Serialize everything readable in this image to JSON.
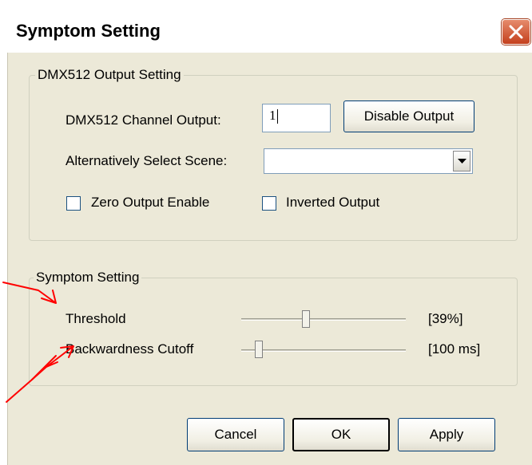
{
  "dialog": {
    "title": "Symptom Setting",
    "close_icon": "close-icon"
  },
  "dmx_group": {
    "label": "DMX512 Output Setting",
    "channel_label": "DMX512 Channel Output:",
    "channel_value": "1",
    "disable_button": "Disable Output",
    "scene_label": "Alternatively Select Scene:",
    "scene_value": "",
    "zero_output_label": "Zero Output Enable",
    "zero_output_checked": false,
    "inverted_output_label": "Inverted Output",
    "inverted_output_checked": false
  },
  "symptom_group": {
    "label": "Symptom Setting",
    "threshold_label": "Threshold",
    "threshold_value": "[39%]",
    "threshold_level": 0.39,
    "cutoff_label": "Backwardness Cutoff",
    "cutoff_value": "[100 ms]",
    "cutoff_level": 0.1
  },
  "buttons": {
    "cancel": "Cancel",
    "ok": "OK",
    "apply": "Apply"
  },
  "colors": {
    "annotation_arrow": "#ff0000",
    "close_button": "#c4401d",
    "dialog_bg": "#ece9d8"
  }
}
